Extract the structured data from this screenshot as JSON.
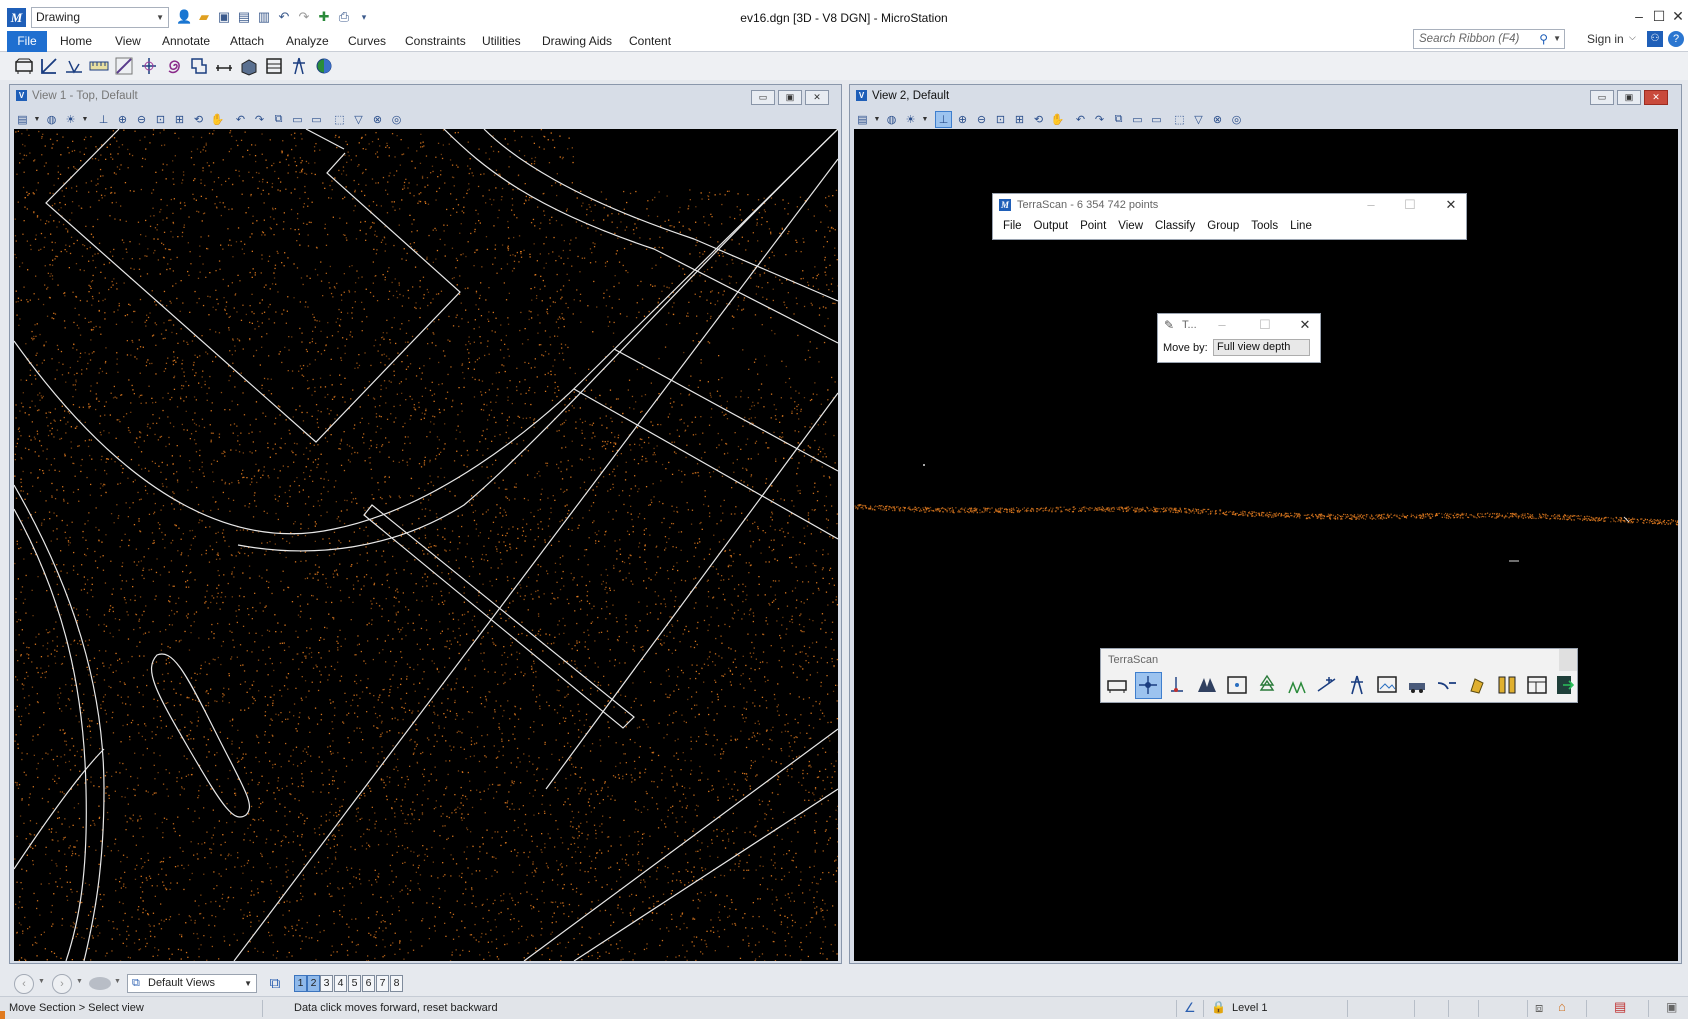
{
  "app": {
    "window_title": "ev16.dgn [3D - V8 DGN] - MicroStation",
    "workflow": "Drawing",
    "logo": "M"
  },
  "ribbon": {
    "tabs": [
      "File",
      "Home",
      "View",
      "Annotate",
      "Attach",
      "Analyze",
      "Curves",
      "Constraints",
      "Utilities",
      "Drawing Aids",
      "Content"
    ],
    "search_placeholder": "Search Ribbon (F4)",
    "sign_in": "Sign in"
  },
  "view1": {
    "title": "View 1 - Top, Default"
  },
  "view2": {
    "title": "View 2, Default"
  },
  "terrascan_main": {
    "title": "TerraScan - 6 354 742 points",
    "menu": [
      "File",
      "Output",
      "Point",
      "View",
      "Classify",
      "Group",
      "Tools",
      "Line"
    ]
  },
  "move_section_dialog": {
    "title": "T...",
    "label": "Move by:",
    "value": "Full view depth"
  },
  "terrascan_toolbar": {
    "title": "TerraScan"
  },
  "view_groups": {
    "selected": "Default Views",
    "view_numbers": [
      "1",
      "2",
      "3",
      "4",
      "5",
      "6",
      "7",
      "8"
    ],
    "active_views": [
      1,
      2
    ]
  },
  "status": {
    "tool_prompt": "Move Section > Select view",
    "message": "Data click moves forward, reset backward",
    "level": "Level 1"
  },
  "colors": {
    "accent": "#1f6fd0",
    "points": "#e07a1f",
    "canvas_bg": "#000000",
    "vector_lines": "#e8e8e8"
  }
}
